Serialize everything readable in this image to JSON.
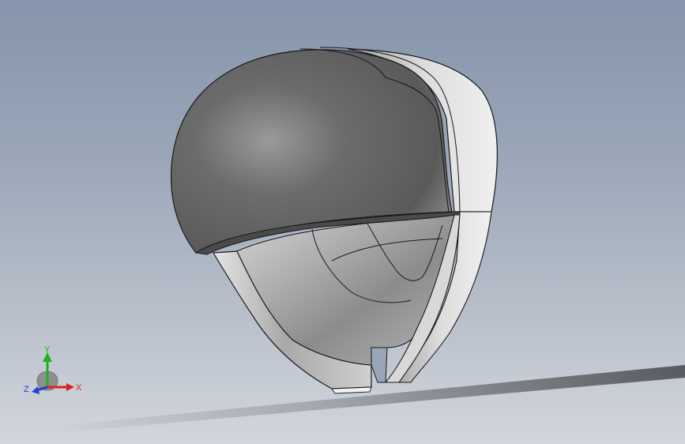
{
  "viewport": {
    "background_top": "#8695ac",
    "background_bottom": "#d2d6dd"
  },
  "model": {
    "shell_color": "#6f6f6f",
    "liner_color": "#c9c9c9",
    "edge_color": "#1a1a1a"
  },
  "triad": {
    "x_label": "X",
    "y_label": "Y",
    "z_label": "Z",
    "x_color": "#e02020",
    "y_color": "#20b020",
    "z_color": "#2040d0"
  }
}
